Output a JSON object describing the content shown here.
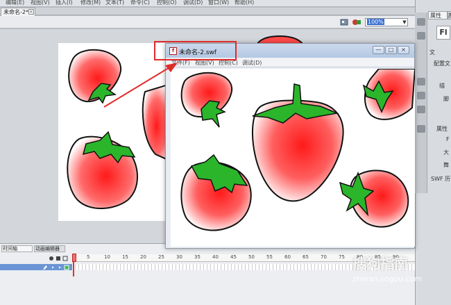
{
  "app": {
    "menubar": [
      "编辑(E)",
      "视图(V)",
      "插入(I)",
      "修改(M)",
      "文本(T)",
      "命令(C)",
      "控制(O)",
      "调试(D)",
      "窗口(W)",
      "帮助(H)"
    ],
    "doc_tab": {
      "label": "未命名-2*",
      "close": "×"
    },
    "zoom": "100%"
  },
  "swf_window": {
    "title": "未命名-2.swf",
    "icon": "flash-player-icon",
    "menu": [
      "文件(F)",
      "视图(V)",
      "控制(C)",
      "调试(D)"
    ],
    "min": "—",
    "max": "□",
    "close": "×"
  },
  "right_panel": {
    "tab_props": "属性",
    "tab_lib": "库",
    "fl_icon": "Fl",
    "rows": [
      "文",
      "配置文",
      "描",
      "脚",
      "属性",
      "F",
      "大",
      "舞",
      "SWF 历"
    ]
  },
  "timeline": {
    "tabs": [
      "时间轴",
      "动画编辑器"
    ],
    "ruler": [
      "1",
      "5",
      "10",
      "15",
      "20",
      "25",
      "30",
      "35",
      "40",
      "45",
      "50",
      "55",
      "60",
      "65",
      "70",
      "75",
      "80",
      "85",
      "90"
    ]
  },
  "watermark": {
    "text": "搜狗指南",
    "url": "zhinan.sogou.com"
  },
  "colors": {
    "strawberry": "#ff1a1a",
    "leaf": "#2bb52b",
    "highlight": "#e02a2a"
  }
}
